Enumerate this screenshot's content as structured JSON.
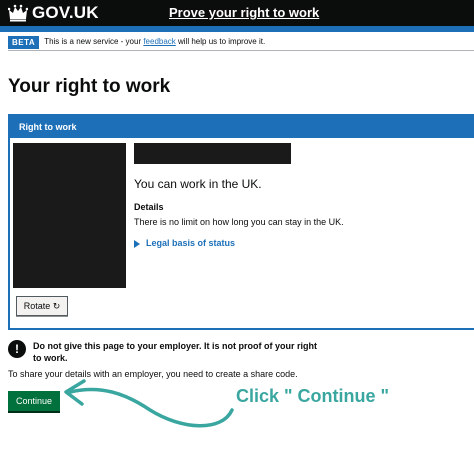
{
  "header": {
    "logo_text": "GOV.UK",
    "logo_icon": "crown-icon",
    "service_name": "Prove your right to work"
  },
  "phase_banner": {
    "tag": "BETA",
    "text_before": "This is a new service - your ",
    "link_text": "feedback",
    "text_after": " will help us to improve it."
  },
  "page": {
    "title": "Your right to work"
  },
  "panel": {
    "heading": "Right to work",
    "status": "You can work in the UK.",
    "details_heading": "Details",
    "details_text": "There is no limit on how long you can stay in the UK.",
    "legal_link": "Legal basis of status",
    "rotate_label": "Rotate ↻"
  },
  "warning": {
    "icon": "!",
    "text": "Do not give this page to your employer. It is not proof of your right to work."
  },
  "share_text": "To share your details with an employer, you need to create a share code.",
  "continue_label": "Continue",
  "annotation": {
    "text": "Click \" Continue \"",
    "color": "#3aa6a0"
  },
  "colors": {
    "header_bg": "#0b0c0c",
    "brand_blue": "#1d70b8",
    "button_green": "#00703c"
  }
}
